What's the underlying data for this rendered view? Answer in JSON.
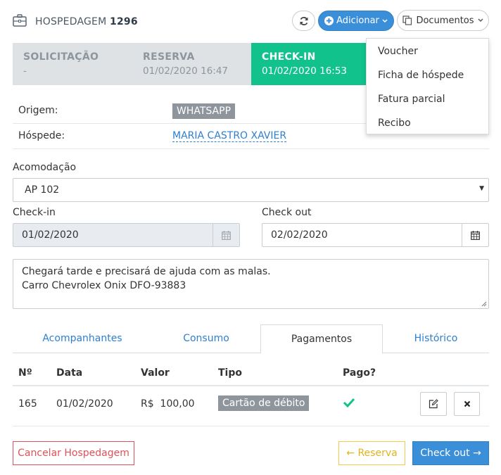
{
  "header": {
    "title_prefix": "HOSPEDAGEM",
    "title_number": "1296",
    "add_label": "Adicionar",
    "documents_label": "Documentos"
  },
  "steps": [
    {
      "label": "SOLICITAÇÃO",
      "value": "-"
    },
    {
      "label": "RESERVA",
      "value": "01/02/2020 16:47"
    },
    {
      "label": "CHECK-IN",
      "value": "01/02/2020 16:53",
      "active": true
    }
  ],
  "documents_menu": [
    "Voucher",
    "Ficha de hóspede",
    "Fatura parcial",
    "Recibo"
  ],
  "info": {
    "origin_label": "Origem:",
    "origin_value": "WHATSAPP",
    "guest_label": "Hóspede:",
    "guest_value": "MARIA CASTRO XAVIER"
  },
  "form": {
    "accommodation_label": "Acomodação",
    "accommodation_value": "AP 102",
    "checkin_label": "Check-in",
    "checkin_value": "01/02/2020",
    "checkout_label": "Check out",
    "checkout_value": "02/02/2020",
    "notes_line1": "Chegará tarde e precisará de ajuda com as malas.",
    "notes_line2": "Carro Chevrolex Onix DFO-93883"
  },
  "tabs": [
    {
      "label": "Acompanhantes"
    },
    {
      "label": "Consumo"
    },
    {
      "label": "Pagamentos",
      "active": true
    },
    {
      "label": "Histórico"
    }
  ],
  "payments": {
    "columns": [
      "Nº",
      "Data",
      "Valor",
      "Tipo",
      "Pago?"
    ],
    "rows": [
      {
        "number": "165",
        "date": "01/02/2020",
        "value": "R$  100,00",
        "type": "Cartão de débito",
        "paid": true
      }
    ]
  },
  "footer": {
    "cancel_label": "Cancelar Hospedagem",
    "back_label": "← Reserva",
    "next_label": "Check out →"
  },
  "colors": {
    "primary": "#3b8fd9",
    "success": "#12c28d",
    "danger": "#e0525a",
    "warning": "#f2c94c",
    "link": "#2d7fd3"
  }
}
